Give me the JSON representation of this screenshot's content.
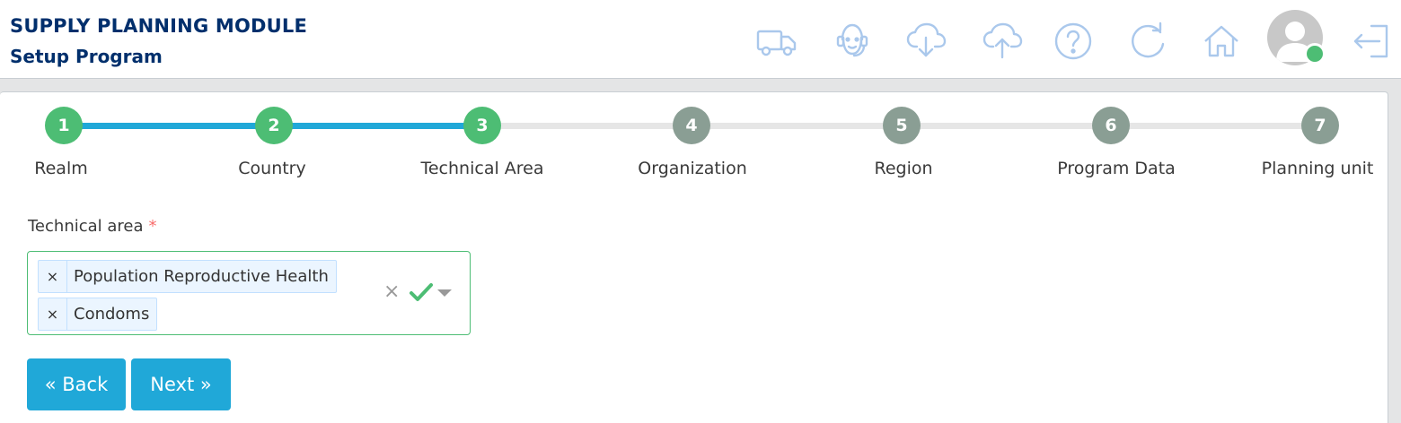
{
  "header": {
    "module_title": "SUPPLY PLANNING MODULE",
    "page_title": "Setup Program",
    "icons": [
      "truck-icon",
      "support-agent-icon",
      "cloud-download-icon",
      "cloud-upload-icon",
      "help-icon",
      "refresh-icon",
      "home-icon",
      "user-avatar",
      "logout-icon"
    ],
    "icon_color": "#aac8ec",
    "online_status_color": "#4dbd74"
  },
  "stepper": {
    "current_step": 3,
    "steps": [
      {
        "number": "1",
        "label": "Realm"
      },
      {
        "number": "2",
        "label": "Country"
      },
      {
        "number": "3",
        "label": "Technical Area"
      },
      {
        "number": "4",
        "label": "Organization"
      },
      {
        "number": "5",
        "label": "Region"
      },
      {
        "number": "6",
        "label": "Program Data"
      },
      {
        "number": "7",
        "label": "Planning unit"
      }
    ],
    "done_color": "#4dbd74",
    "todo_color": "#8a9e94",
    "track_done_color": "#20a8d8"
  },
  "form": {
    "label": "Technical area",
    "required_mark": "*",
    "selected": [
      {
        "remove": "×",
        "text": "Population Reproductive Health"
      },
      {
        "remove": "×",
        "text": "Condoms"
      }
    ],
    "clear": "×"
  },
  "buttons": {
    "back": "« Back",
    "next": "Next »"
  }
}
